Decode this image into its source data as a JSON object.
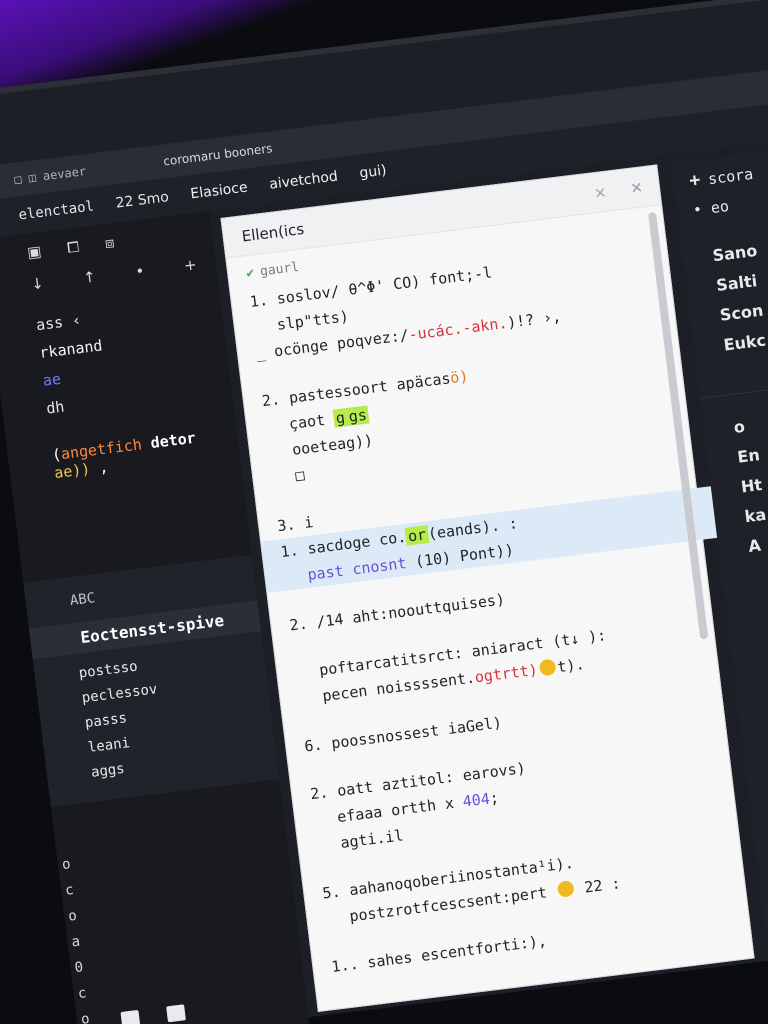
{
  "window": {
    "icons": [
      "shield-icon",
      "heart-icon",
      "gear-icon"
    ]
  },
  "titlebar": {
    "crumbs": "□ ◫ aevaer",
    "tab": "coromaru booners",
    "count": "22 Smo"
  },
  "menubar": {
    "label": "elenctaol",
    "items": [
      "Elasioce",
      "aivetchod",
      "gui)"
    ]
  },
  "sidebar": {
    "toolbar": [
      "▣",
      "⧠",
      "⧈"
    ],
    "toolbar2": [
      "↓",
      "↑",
      "•",
      "+"
    ],
    "code_lines": [
      "ass ‹",
      "rkanand",
      "ae",
      "dh"
    ],
    "call": {
      "paren": "(",
      "fn": "angetfich",
      "kw": "detor",
      "arg": "ae))",
      "tail": ","
    },
    "section_title": "ABC",
    "active_item": "Eoctensst-spive",
    "items": [
      "postsso",
      "peclessov",
      "passs",
      "leani",
      "aggs"
    ],
    "gutter": [
      "o",
      "c",
      "o",
      "a",
      "0",
      "c",
      "o",
      "0"
    ]
  },
  "editor": {
    "tab": "Ellen(ics",
    "status": "gaurl",
    "lines": {
      "l1": "1. soslov/ θ^Φ' CO) font;-l",
      "l2": "slp\"tts)",
      "l3a": "_ ocönge poqvez:/",
      "l3b": "-ucác.",
      "l3c": "-akn.",
      "l3d": ")!?  ›,",
      "l4a": "2. pastessoort apäcas",
      "l4b": "ö)",
      "l5a": "çaot",
      "l5b": "g",
      "l5c": "gs",
      "l6": "ooeteag))",
      "l7": "□",
      "l8": "3. i",
      "l9a": "1. sacdoge co.",
      "l9b": "or",
      "l9c": "(eands). :",
      "l10a": "past",
      "l10b": "cnosnt",
      "l10c": "(10) Pont))",
      "l11": "2. /14 aht:noouttquises)",
      "l12": "poftarcatitsrct: aniaract (t↓ ):",
      "l13a": "pecen noissssent.",
      "l13b": "ogtrtt)",
      "l13c": "t).",
      "l14": "6. poossnossest iaGel)",
      "l15": "2. oatt aztitol: earovs)",
      "l16a": "efaaa ortth x",
      "l16b": "404",
      "l16c": ";",
      "l17": "agti.il",
      "l18": "5. aahanoqoberiinostanta¹i).",
      "l19a": "postzrotfcescsent:pert",
      "l19b": "22 :",
      "l20": "1.. sahes escentforti:),"
    },
    "win_controls": [
      "×",
      "✕"
    ]
  },
  "rpanel": {
    "head": "scora",
    "head_plus": "+",
    "dots": "• eo",
    "items": [
      "Sano",
      "Salti",
      "Scon",
      "Eukc"
    ],
    "sub_head": "o",
    "sub_items": [
      "En",
      "Ht",
      "ka",
      "A"
    ]
  }
}
